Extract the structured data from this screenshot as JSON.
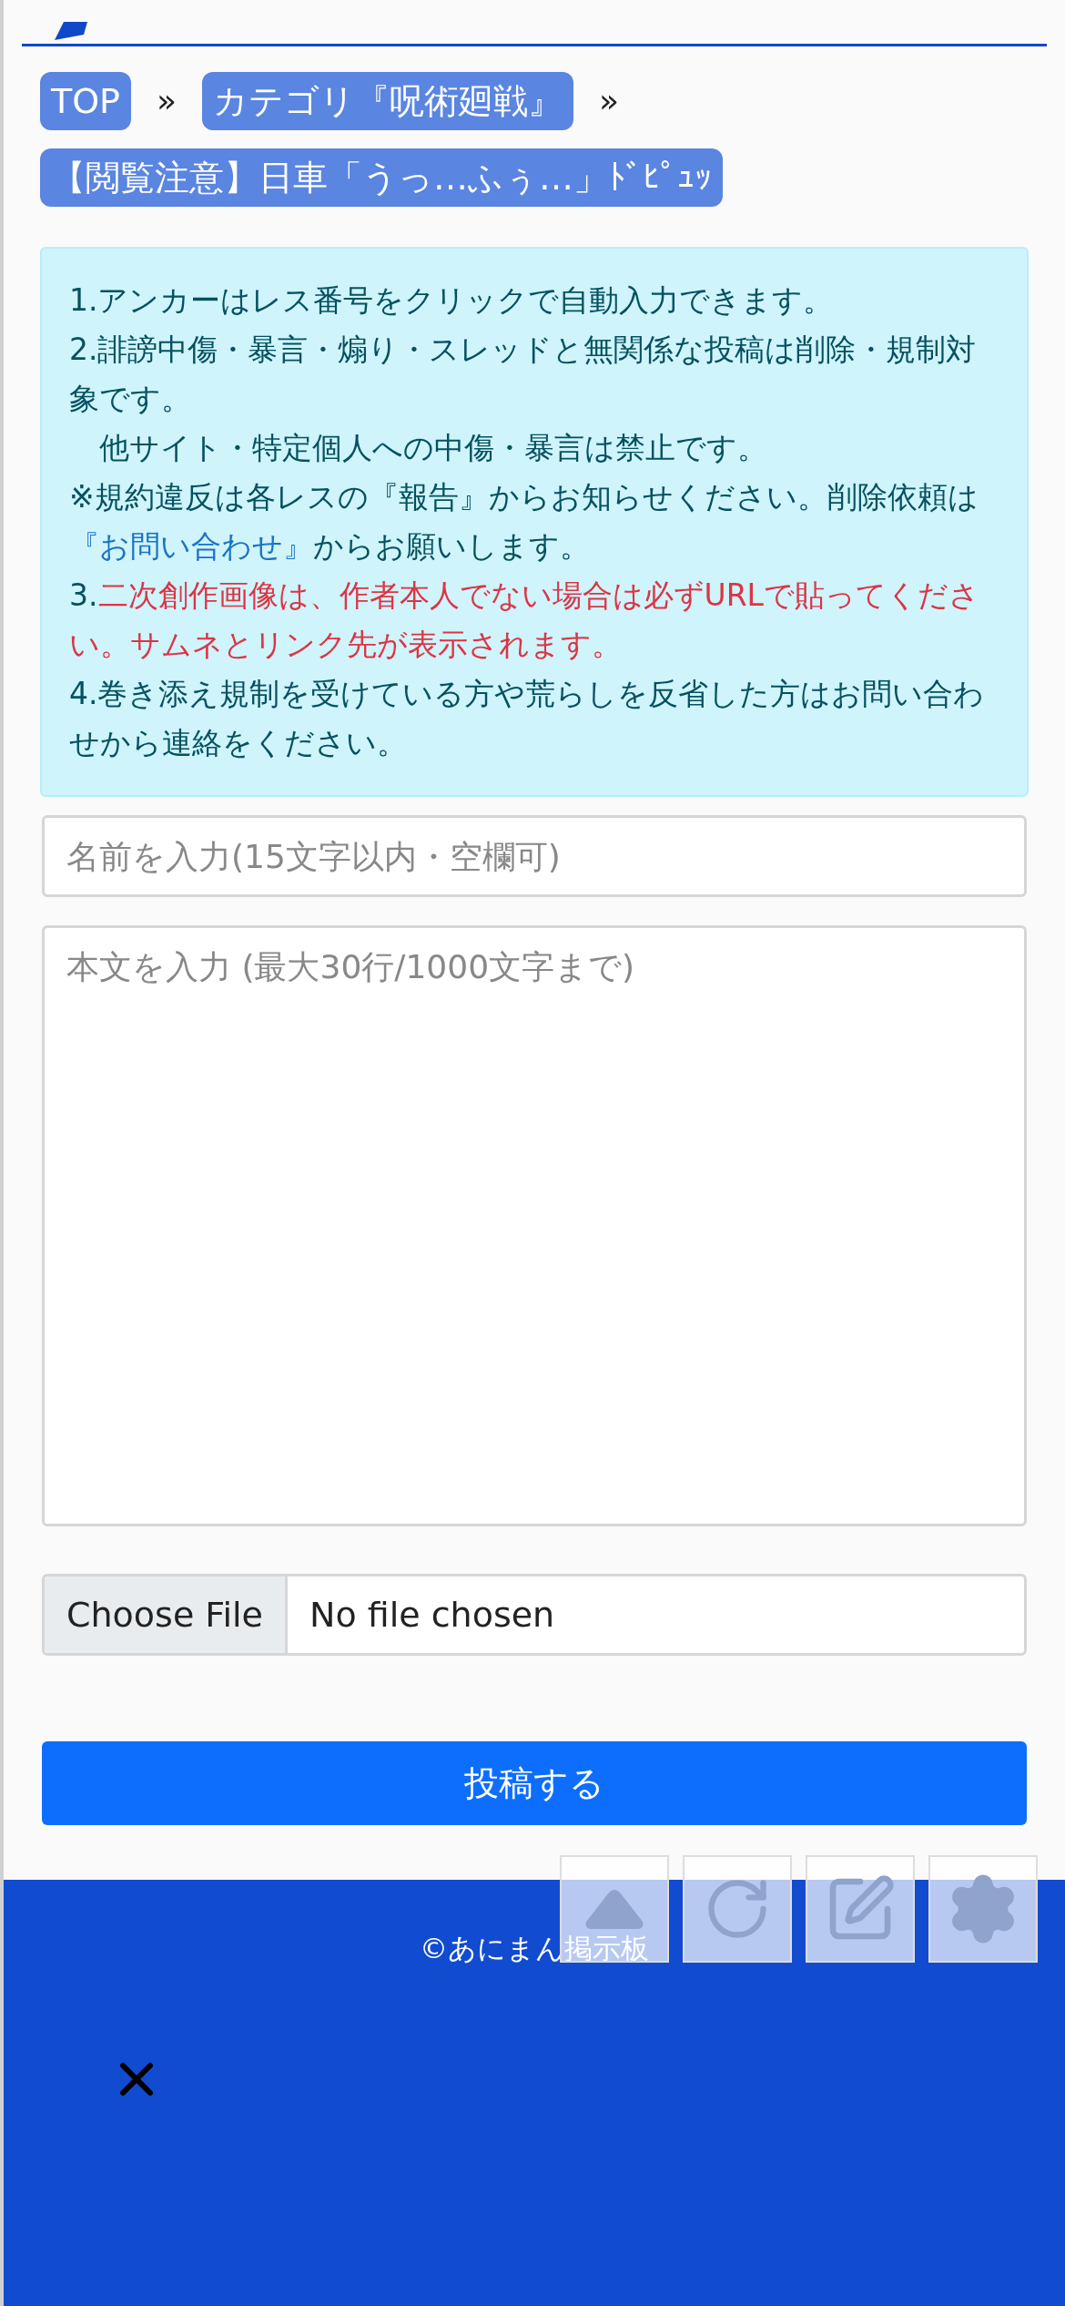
{
  "breadcrumbs": [
    {
      "label": "TOP",
      "separator": "»"
    },
    {
      "label": "カテゴリ『呪術廻戦』",
      "separator": "»"
    },
    {
      "label": "【閲覧注意】日車「うっ…ふぅ…」ﾄﾞﾋﾟｭｯ"
    }
  ],
  "notice": [
    [
      {
        "kind": "text",
        "text": "1.アンカーはレス番号をクリックで自動入力できます。"
      }
    ],
    [
      {
        "kind": "text",
        "text": "2.誹謗中傷・暴言・煽り・スレッドと無関係な投稿は削除・規制対象です。"
      }
    ],
    [
      {
        "kind": "text",
        "text": "　他サイト・特定個人への中傷・暴言は禁止です。"
      }
    ],
    [
      {
        "kind": "text",
        "text": "※規約違反は各レスの『報告』からお知らせください。削除依頼は"
      },
      {
        "kind": "link",
        "text": "『お問い合わせ』"
      },
      {
        "kind": "text",
        "text": "からお願いします。"
      }
    ],
    [
      {
        "kind": "text",
        "text": "3."
      },
      {
        "kind": "warning",
        "text": "二次創作画像は、作者本人でない場合は必ずURLで貼ってください。サムネとリンク先が表示されます。"
      }
    ],
    [
      {
        "kind": "text",
        "text": "4.巻き添え規制を受けている方や荒らしを反省した方はお問い合わせから連絡をください。"
      }
    ]
  ],
  "form": {
    "name_placeholder": "名前を入力(15文字以内・空欄可)",
    "body_placeholder": "本文を入力 (最大30行/1000文字まで)",
    "file_button": "Choose File",
    "file_status": "No file chosen",
    "submit": "投稿する"
  },
  "footer": {
    "copyright": "©あにまん掲示板"
  }
}
